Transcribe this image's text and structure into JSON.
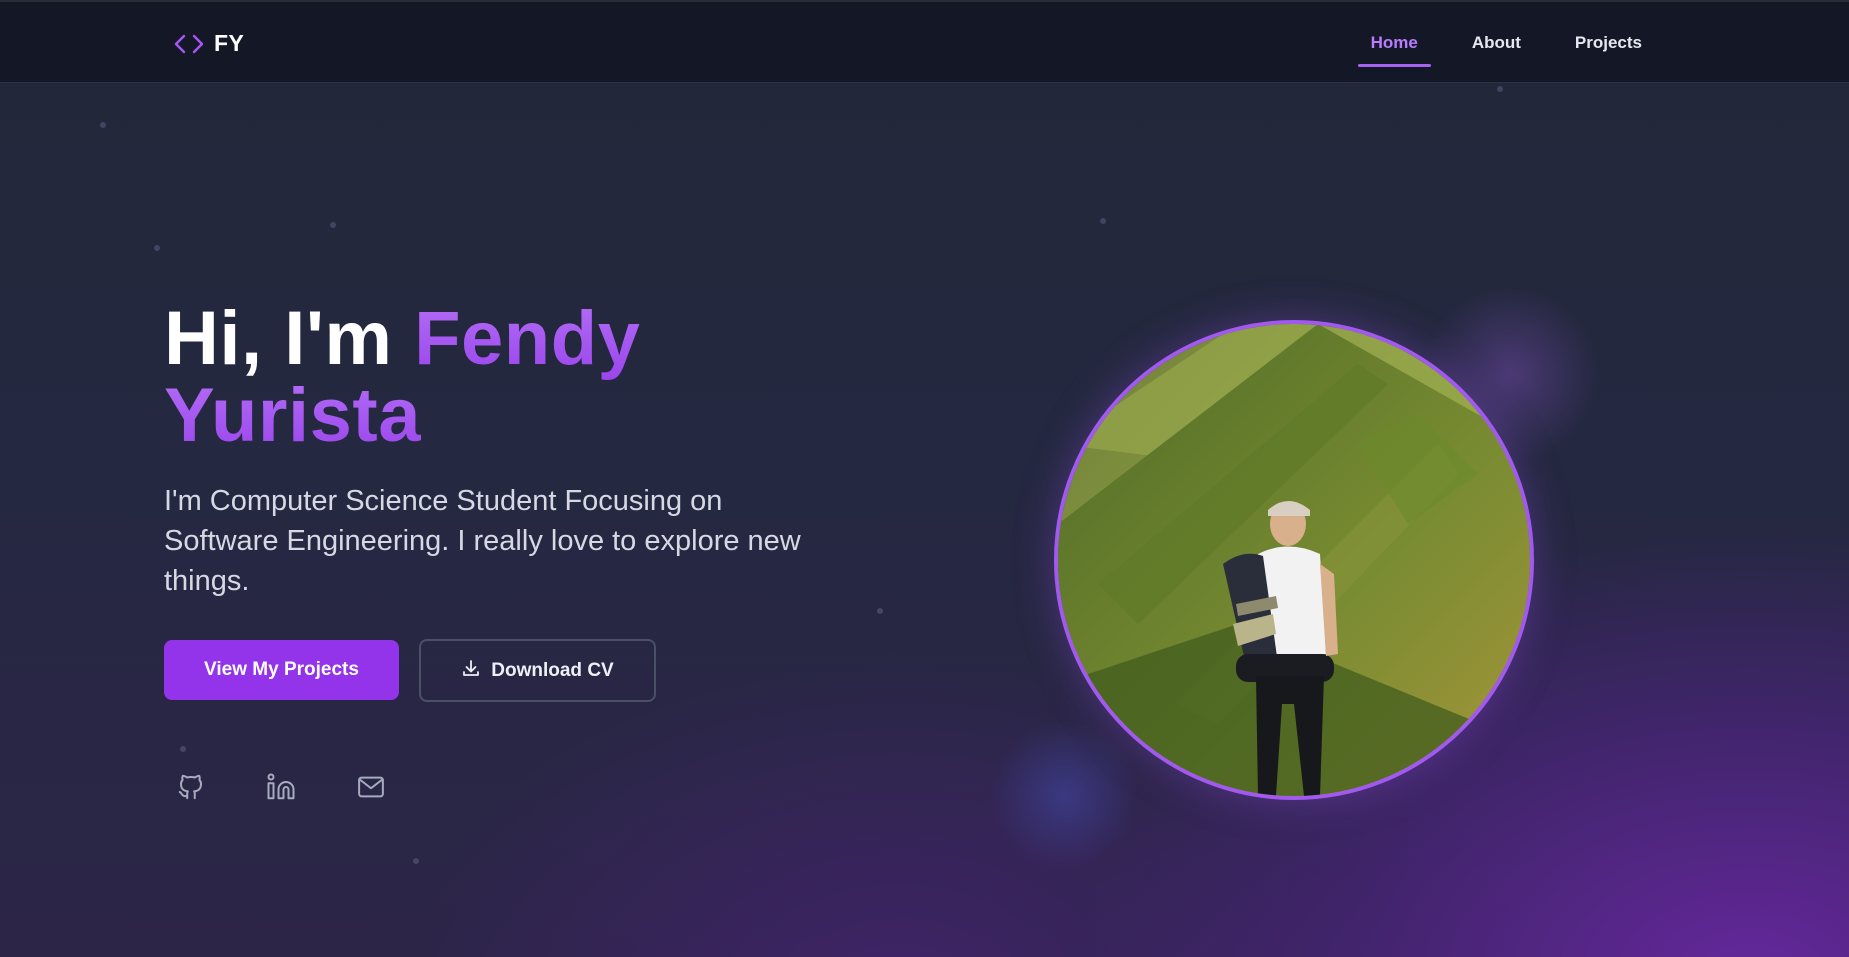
{
  "brand": {
    "logo_text": "FY",
    "logo_icon": "code-brackets-icon",
    "accent": "#a855f7"
  },
  "nav": {
    "items": [
      {
        "label": "Home",
        "active": true
      },
      {
        "label": "About",
        "active": false
      },
      {
        "label": "Projects",
        "active": false
      }
    ]
  },
  "hero": {
    "greeting": "Hi, I'm ",
    "first_name": "Fendy",
    "last_name": "Yurista",
    "subtitle": "I'm Computer Science Student Focusing on Software Engineering. I really love to explore new things.",
    "primary_button": "View My Projects",
    "secondary_button": "Download CV",
    "secondary_icon": "download-icon"
  },
  "socials": [
    {
      "icon": "github-icon"
    },
    {
      "icon": "linkedin-icon"
    },
    {
      "icon": "mail-icon"
    }
  ],
  "colors": {
    "primary_button": "#9333ea",
    "nav_active": "#b77cff",
    "avatar_ring": "#a259f0"
  }
}
